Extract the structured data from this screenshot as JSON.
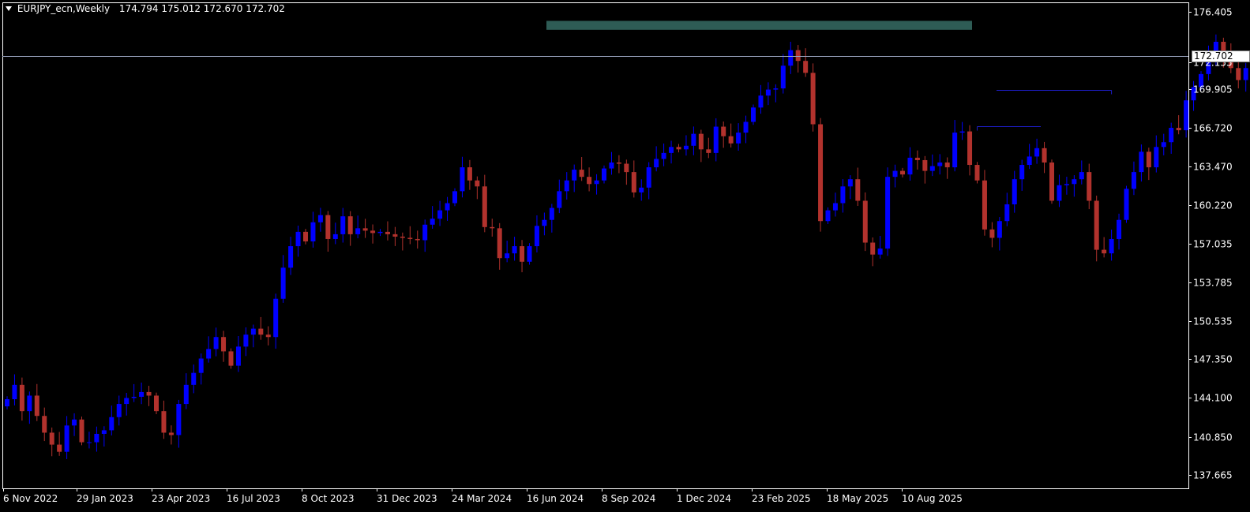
{
  "header": {
    "symbol": "EURJPY_ecn,Weekly",
    "ohlc": "174.794 175.012 172.670 172.702"
  },
  "colors": {
    "background": "#000000",
    "bull_candle": "#0000ff",
    "bear_candle": "#b2322d",
    "axis": "#ffffff",
    "current_price_line": "#9aa4c0",
    "level_line": "#1d1dc8",
    "resistance_zone": "#2e5c55"
  },
  "chart_data": {
    "type": "candlestick",
    "symbol": "EURJPY_ecn",
    "timeframe": "Weekly",
    "y_axis_ticks": [
      "176.405",
      "172.155",
      "169.905",
      "166.720",
      "163.470",
      "160.220",
      "157.035",
      "153.785",
      "150.535",
      "147.350",
      "144.100",
      "140.850",
      "137.665"
    ],
    "x_axis_ticks": [
      "6 Nov 2022",
      "29 Jan 2023",
      "23 Apr 2023",
      "16 Jul 2023",
      "8 Oct 2023",
      "31 Dec 2023",
      "24 Mar 2024",
      "16 Jun 2024",
      "8 Sep 2024",
      "1 Dec 2024",
      "23 Feb 2025",
      "18 May 2025",
      "10 Aug 2025"
    ],
    "ylim": [
      136.2,
      177.3
    ],
    "current_price": "172.702",
    "current_price_value": 172.702,
    "resistance_zone": {
      "from": 174.9,
      "to": 175.65
    },
    "horizontal_levels": [
      {
        "price": 169.9,
        "start_index": 148
      },
      {
        "price": 166.85,
        "start_index": 130
      }
    ],
    "closes": [
      144.0,
      145.2,
      143.0,
      144.3,
      142.6,
      141.2,
      140.2,
      139.6,
      141.8,
      142.3,
      140.4,
      140.4,
      141.1,
      141.4,
      142.5,
      143.6,
      144.1,
      144.2,
      144.6,
      144.3,
      143.0,
      141.2,
      141.0,
      143.6,
      145.2,
      146.2,
      147.4,
      148.2,
      149.2,
      148.0,
      146.8,
      148.4,
      149.4,
      149.9,
      149.4,
      149.2,
      152.4,
      155.0,
      156.8,
      158.0,
      157.2,
      158.8,
      159.4,
      157.4,
      157.8,
      159.3,
      157.8,
      158.3,
      158.1,
      157.9,
      158.0,
      157.8,
      157.6,
      157.5,
      157.4,
      157.3,
      158.6,
      159.1,
      159.8,
      160.4,
      161.4,
      163.4,
      162.3,
      161.8,
      158.4,
      158.3,
      155.8,
      156.2,
      156.8,
      155.5,
      156.8,
      158.5,
      159.0,
      160.0,
      161.4,
      162.3,
      163.2,
      162.6,
      162.0,
      162.3,
      163.3,
      163.8,
      163.7,
      163.0,
      161.3,
      161.7,
      163.4,
      164.1,
      164.6,
      165.1,
      164.9,
      165.2,
      166.2,
      164.9,
      164.6,
      166.8,
      166.0,
      165.4,
      166.3,
      167.2,
      168.4,
      169.4,
      169.9,
      170.0,
      171.9,
      173.2,
      172.3,
      171.3,
      167.0,
      158.9,
      159.8,
      160.4,
      161.8,
      162.4,
      160.6,
      157.1,
      156.1,
      156.6,
      162.6,
      163.1,
      162.8,
      164.2,
      164.0,
      163.1,
      163.5,
      163.8,
      163.4,
      166.3,
      166.4,
      163.6,
      162.3,
      158.2,
      157.5,
      158.9,
      160.3,
      162.4,
      163.6,
      164.3,
      165.0,
      163.8,
      160.6,
      161.9,
      162.0,
      162.4,
      163.0,
      160.6,
      156.5,
      156.2,
      157.4,
      159.0,
      161.6,
      163.0,
      164.7,
      163.4,
      165.1,
      165.5,
      166.7,
      166.5,
      169.0,
      170.1,
      171.2,
      172.7,
      173.9,
      172.8,
      171.7,
      170.7,
      171.7,
      172.3,
      172.6,
      172.5,
      172.4,
      173.1,
      174.0,
      174.79,
      172.7
    ],
    "bull_range": [
      0,
      160
    ],
    "bear_range": [
      160,
      220
    ]
  }
}
